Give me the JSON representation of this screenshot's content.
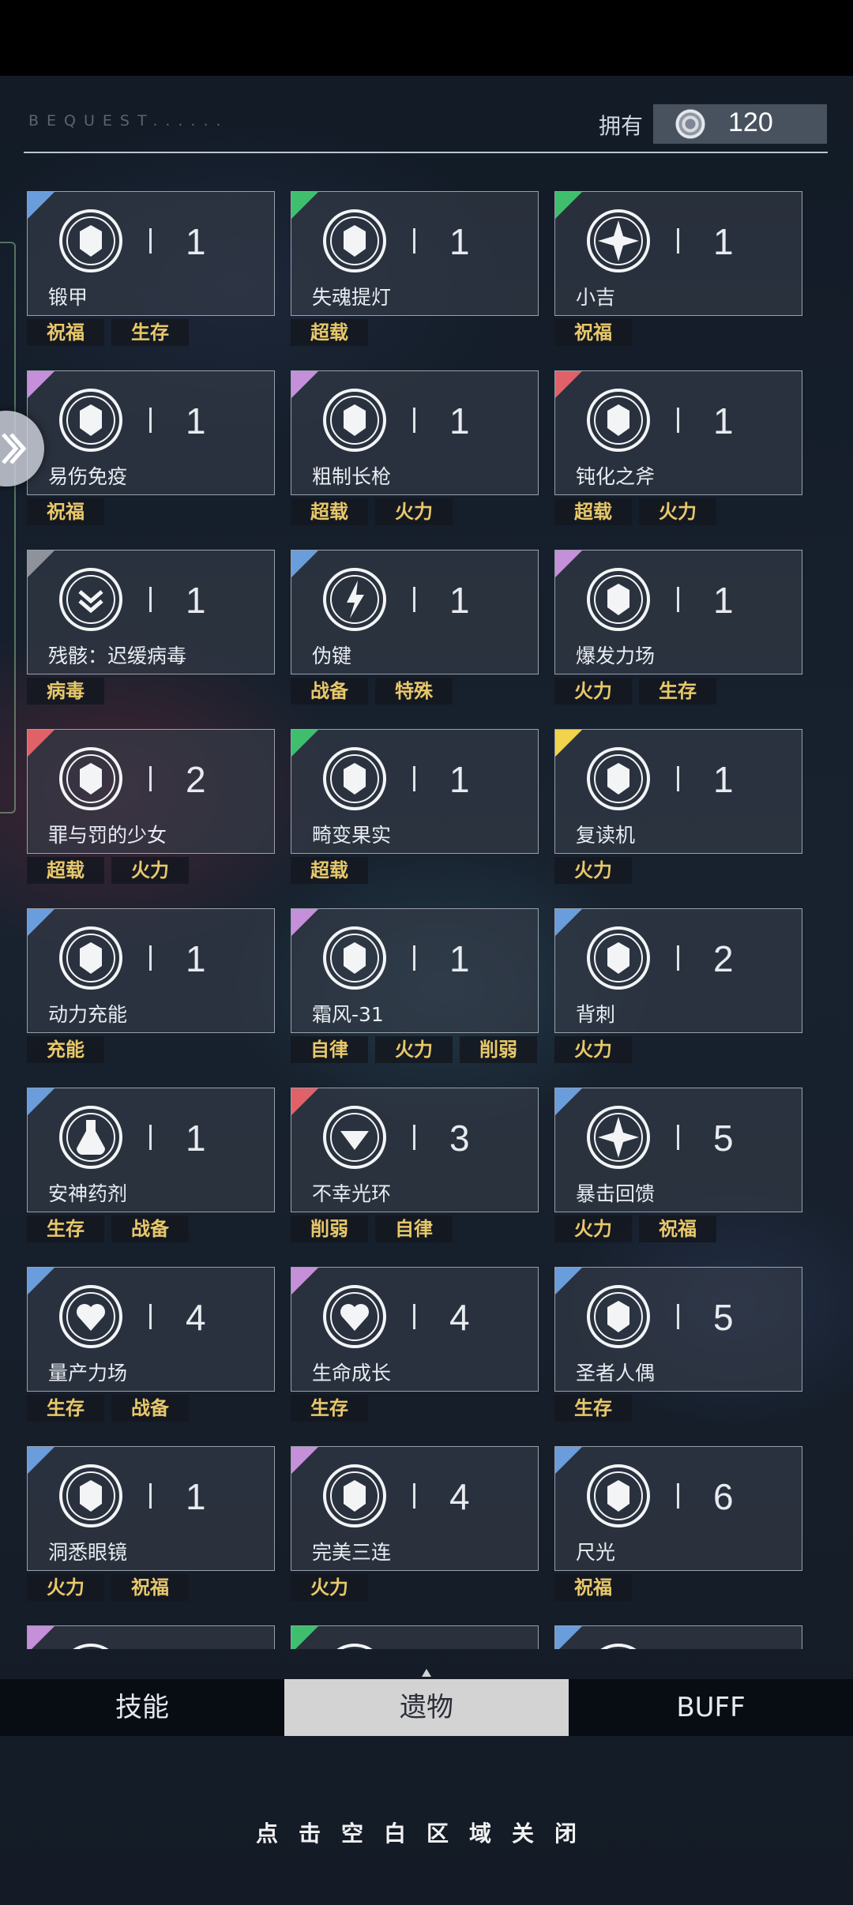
{
  "header": {
    "bequest_label": "BEQUEST......",
    "owned_label": "拥有",
    "owned_count": "120",
    "owned_icon": "currency-ring-icon"
  },
  "colors": {
    "blue": "#6a9ddb",
    "green": "#3fbf6e",
    "purple": "#c58fd9",
    "red": "#e06268",
    "gray": "#8e929a",
    "yellow": "#f2d34c",
    "tag_text": "#e8c86a"
  },
  "items": [
    {
      "name": "锻甲",
      "count": "1",
      "corner": "blue",
      "icon": "armor-m-icon",
      "tags": [
        "祝福",
        "生存"
      ]
    },
    {
      "name": "失魂提灯",
      "count": "1",
      "corner": "green",
      "icon": "lantern-icon",
      "tags": [
        "超载"
      ]
    },
    {
      "name": "小吉",
      "count": "1",
      "corner": "green",
      "icon": "star-compass-icon",
      "tags": [
        "祝福"
      ]
    },
    {
      "name": "易伤免疫",
      "count": "1",
      "corner": "purple",
      "icon": "broken-shield-icon",
      "tags": [
        "祝福"
      ]
    },
    {
      "name": "粗制长枪",
      "count": "1",
      "corner": "purple",
      "icon": "spear-icon",
      "tags": [
        "超载",
        "火力"
      ]
    },
    {
      "name": "钝化之斧",
      "count": "1",
      "corner": "red",
      "icon": "axe-icon",
      "tags": [
        "超载",
        "火力"
      ]
    },
    {
      "name": "残骸：迟缓病毒",
      "count": "1",
      "corner": "gray",
      "icon": "double-chevron-icon",
      "tags": [
        "病毒"
      ]
    },
    {
      "name": "伪键",
      "count": "1",
      "corner": "blue",
      "icon": "lightning-icon",
      "tags": [
        "战备",
        "特殊"
      ]
    },
    {
      "name": "爆发力场",
      "count": "1",
      "corner": "purple",
      "icon": "flower-gear-icon",
      "tags": [
        "火力",
        "生存"
      ]
    },
    {
      "name": "罪与罚的少女",
      "count": "2",
      "corner": "red",
      "icon": "maiden-icon",
      "tags": [
        "超载",
        "火力"
      ]
    },
    {
      "name": "畸变果实",
      "count": "1",
      "corner": "green",
      "icon": "fruit-icon",
      "tags": [
        "超载"
      ]
    },
    {
      "name": "复读机",
      "count": "1",
      "corner": "yellow",
      "icon": "cassette-icon",
      "tags": [
        "火力"
      ]
    },
    {
      "name": "动力充能",
      "count": "1",
      "corner": "blue",
      "icon": "charge-swirl-icon",
      "tags": [
        "充能"
      ]
    },
    {
      "name": "霜风-31",
      "count": "1",
      "corner": "purple",
      "icon": "frost-mech-icon",
      "tags": [
        "自律",
        "火力",
        "削弱"
      ]
    },
    {
      "name": "背刺",
      "count": "2",
      "corner": "blue",
      "icon": "backstab-figure-icon",
      "tags": [
        "火力"
      ]
    },
    {
      "name": "安神药剂",
      "count": "1",
      "corner": "blue",
      "icon": "potion-icon",
      "tags": [
        "生存",
        "战备"
      ]
    },
    {
      "name": "不幸光环",
      "count": "3",
      "corner": "red",
      "icon": "down-arrow-ring-icon",
      "tags": [
        "削弱",
        "自律"
      ]
    },
    {
      "name": "暴击回馈",
      "count": "5",
      "corner": "blue",
      "icon": "critical-burst-icon",
      "tags": [
        "火力",
        "祝福"
      ]
    },
    {
      "name": "量产力场",
      "count": "4",
      "corner": "blue",
      "icon": "heart-hex-icon",
      "tags": [
        "生存",
        "战备"
      ]
    },
    {
      "name": "生命成长",
      "count": "4",
      "corner": "purple",
      "icon": "heart-leaf-icon",
      "tags": [
        "生存"
      ]
    },
    {
      "name": "圣者人偶",
      "count": "5",
      "corner": "blue",
      "icon": "saint-doll-icon",
      "tags": [
        "生存"
      ]
    },
    {
      "name": "洞悉眼镜",
      "count": "1",
      "corner": "blue",
      "icon": "glasses-icon",
      "tags": [
        "火力",
        "祝福"
      ]
    },
    {
      "name": "完美三连",
      "count": "4",
      "corner": "purple",
      "icon": "triple-swirl-icon",
      "tags": [
        "火力"
      ]
    },
    {
      "name": "尺光",
      "count": "6",
      "corner": "blue",
      "icon": "ruler-light-icon",
      "tags": [
        "祝福"
      ]
    },
    {
      "name": "",
      "count": "",
      "corner": "purple",
      "icon": "partial-icon",
      "tags": []
    },
    {
      "name": "",
      "count": "",
      "corner": "green",
      "icon": "partial-icon",
      "tags": []
    },
    {
      "name": "",
      "count": "",
      "corner": "blue",
      "icon": "partial-icon",
      "tags": []
    }
  ],
  "tabs": [
    {
      "label": "技能",
      "active": false
    },
    {
      "label": "遗物",
      "active": true
    },
    {
      "label": "BUFF",
      "active": false
    }
  ],
  "close_hint": "点击空白区域关闭"
}
